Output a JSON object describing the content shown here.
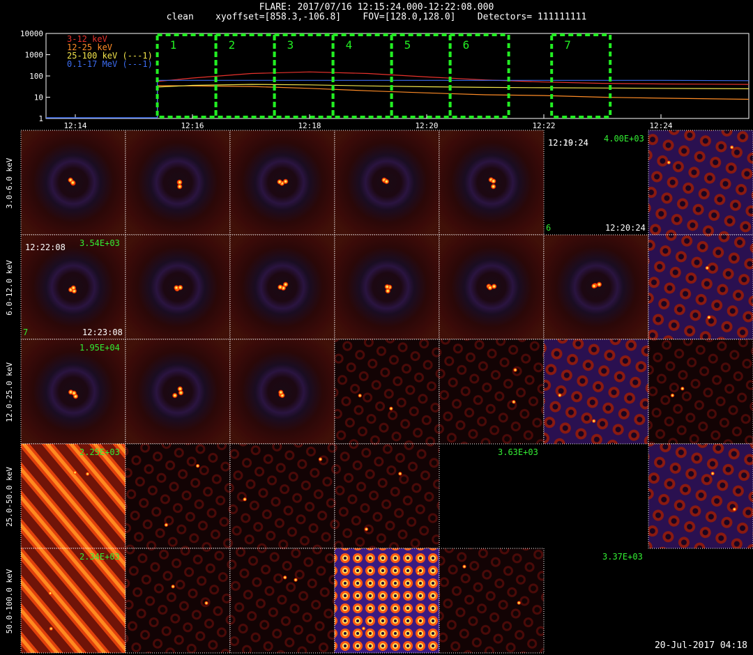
{
  "header": {
    "line1": "FLARE: 2017/07/16 12:15:24.000-12:22:08.000",
    "line2": "clean    xyoffset=[858.3,-106.8]    FOV=[128.0,128.0]    Detectors= 111111111"
  },
  "chart_data": [
    {
      "type": "line",
      "yscale": "log",
      "ylim": [
        1,
        10000
      ],
      "yticks": [
        "1",
        "10",
        "100",
        "1000",
        "10000"
      ],
      "xlim": [
        "12:13:30",
        "12:25:30"
      ],
      "xticks": [
        "12:14",
        "12:16",
        "12:18",
        "12:20",
        "12:22",
        "12:24"
      ],
      "legend_position": "top-left",
      "series": [
        {
          "name": "3-12 keV",
          "color": "#e8322c",
          "x": [
            "12:15:24",
            "12:16:00",
            "12:17:00",
            "12:18:00",
            "12:19:00",
            "12:20:00",
            "12:21:00",
            "12:22:00",
            "12:23:00",
            "12:24:00",
            "12:25:30"
          ],
          "values": [
            55,
            80,
            130,
            155,
            130,
            90,
            65,
            52,
            45,
            42,
            40
          ]
        },
        {
          "name": "12-25 keV",
          "color": "#ff8c26",
          "x": [
            "12:15:24",
            "12:16:00",
            "12:17:00",
            "12:18:00",
            "12:19:00",
            "12:20:00",
            "12:21:00",
            "12:22:00",
            "12:23:00",
            "12:24:00",
            "12:25:30"
          ],
          "values": [
            35,
            34,
            32,
            26,
            20,
            16,
            13,
            12,
            10,
            9,
            8
          ]
        },
        {
          "name": "25-100 keV (---1)",
          "color": "#f2e44a",
          "x": [
            "12:15:24",
            "12:16:00",
            "12:17:00",
            "12:18:00",
            "12:19:00",
            "12:20:00",
            "12:21:00",
            "12:22:00",
            "12:23:00",
            "12:24:00",
            "12:25:30"
          ],
          "values": [
            30,
            36,
            40,
            38,
            34,
            31,
            29,
            28,
            27,
            26,
            25
          ]
        },
        {
          "name": "0.1-17 MeV (---1)",
          "color": "#3c6cf0",
          "x": [
            "12:15:24",
            "12:16:00",
            "12:17:00",
            "12:18:00",
            "12:19:00",
            "12:20:00",
            "12:21:00",
            "12:22:00",
            "12:23:00",
            "12:24:00",
            "12:25:30"
          ],
          "values": [
            62,
            62,
            62,
            62,
            62,
            62,
            62,
            62,
            62,
            62,
            60
          ]
        }
      ],
      "intervals": [
        {
          "label": "1",
          "start": "12:15:24",
          "end": "12:16:24"
        },
        {
          "label": "2",
          "start": "12:16:24",
          "end": "12:17:24"
        },
        {
          "label": "3",
          "start": "12:17:24",
          "end": "12:18:24"
        },
        {
          "label": "4",
          "start": "12:18:24",
          "end": "12:19:24"
        },
        {
          "label": "5",
          "start": "12:19:24",
          "end": "12:20:24"
        },
        {
          "label": "6",
          "start": "12:20:24",
          "end": "12:21:24"
        },
        {
          "label": "7",
          "start": "12:22:08",
          "end": "12:23:08"
        }
      ]
    },
    {
      "type": "heatmap",
      "rows": [
        "3.0-6.0 keV",
        "6.0-12.0 keV",
        "12.0-25.0 keV",
        "25.0-50.0 keV",
        "50.0-100.0 keV"
      ],
      "columns": [
        "1",
        "2",
        "3",
        "4",
        "5",
        "6",
        "7"
      ],
      "panels": [
        [
          "clean",
          "clean",
          "clean",
          "clean",
          "clean",
          "empty",
          "noise-purple"
        ],
        [
          "clean",
          "clean",
          "clean",
          "clean",
          "clean",
          "clean",
          "noise-purple"
        ],
        [
          "clean",
          "clean",
          "clean",
          "noise-dark",
          "noise-dark",
          "noise-purple",
          "noise-dark"
        ],
        [
          "noise-bright",
          "noise-dark",
          "noise-dark",
          "noise-dark",
          "empty",
          "empty",
          "noise-purple"
        ],
        [
          "noise-bright",
          "noise-dark",
          "noise-dark",
          "noise-saturated",
          "noise-dark",
          "empty",
          "empty"
        ]
      ]
    }
  ],
  "annotations": {
    "r0_peak": "4.00E+03",
    "r0_start": "12:19:24",
    "r0_start_overlap": "12:20:24",
    "r0_end": "12:20:24",
    "r0_num": "6",
    "r1_peak": "3.54E+03",
    "r1_start": "12:22:08",
    "r1_end": "12:23:08",
    "r1_num": "7",
    "r2_peak": "1.95E+04",
    "r3_peak": "2.25E+03",
    "r3_peak2": "3.63E+03",
    "r4_peak": "2.34E+03",
    "r4_peak2": "3.37E+03"
  },
  "footer": {
    "stamp": "20-Jul-2017 04:18"
  }
}
